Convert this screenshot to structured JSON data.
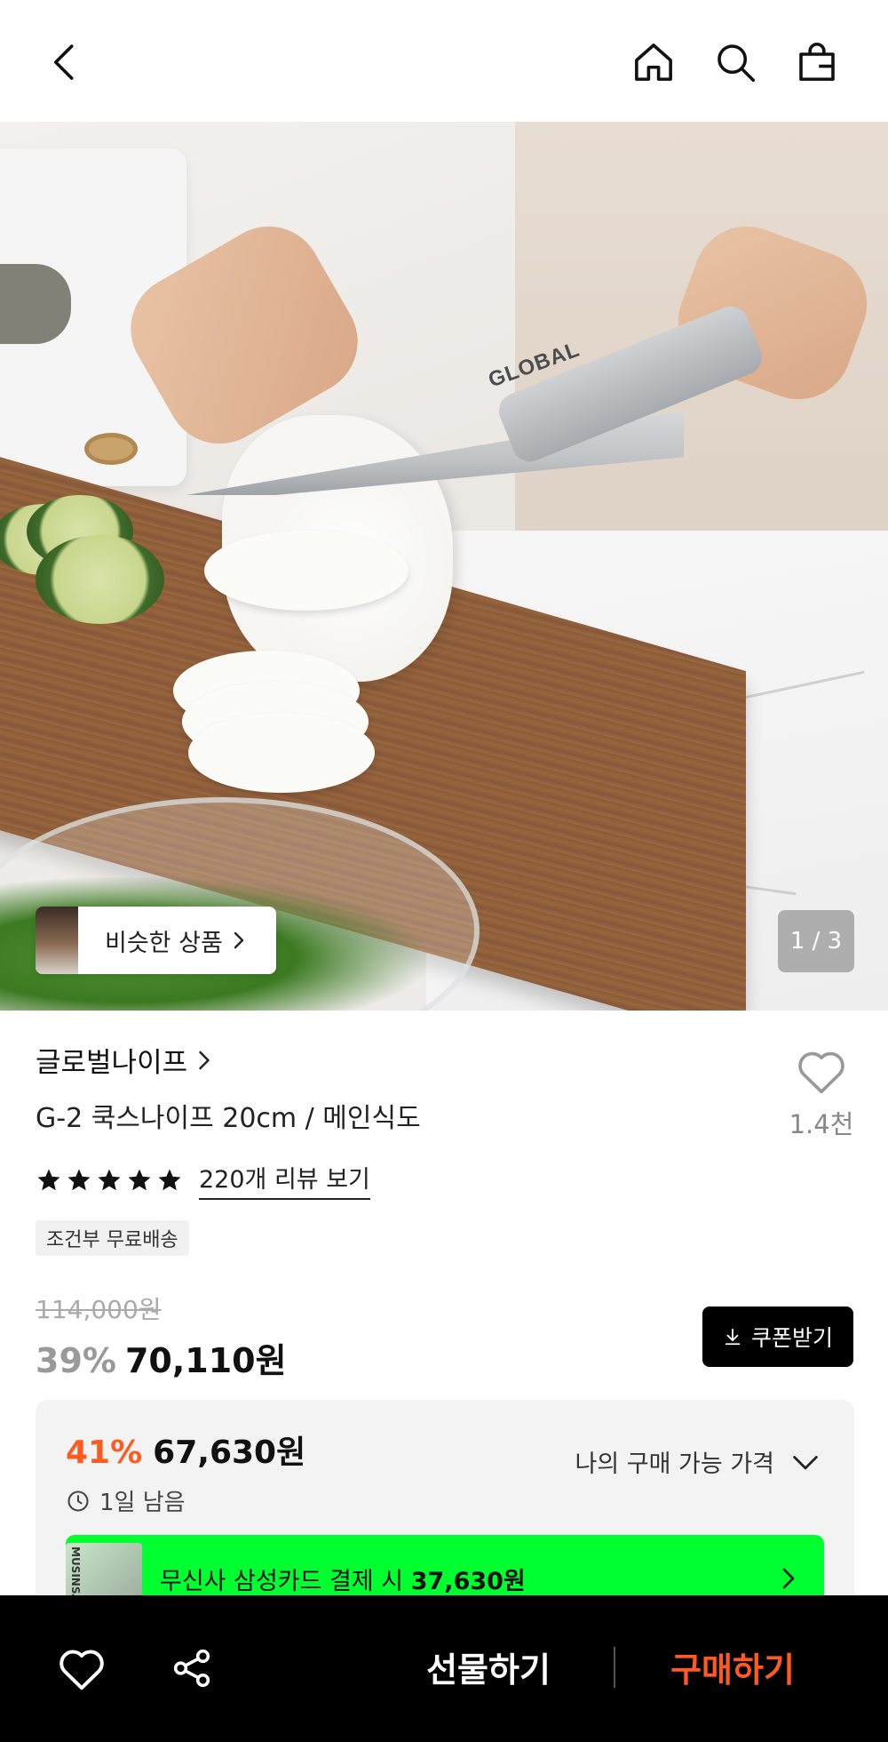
{
  "header": {
    "back_icon": "chevron-left-icon",
    "home_icon": "home-icon",
    "search_icon": "search-icon",
    "cart_icon": "shopping-bag-icon"
  },
  "gallery": {
    "similar_label": "비슷한 상품",
    "page_counter": "1 / 3",
    "knife_brand_engraving": "GLOBAL"
  },
  "product": {
    "brand": "글로벌나이프",
    "name": "G-2 쿡스나이프 20cm / 메인식도",
    "like_count": "1.4천",
    "rating_stars": 5,
    "review_link": "220개 리뷰 보기",
    "shipping_badge": "조건부 무료배송"
  },
  "pricing": {
    "original_price": "114,000원",
    "discount_pct": "39%",
    "sale_price": "70,110원",
    "coupon_label": "쿠폰받기"
  },
  "price_panel": {
    "best_pct": "41%",
    "best_price": "67,630원",
    "remaining": "1일 남음",
    "my_price_label": "나의 구매 가능 가격",
    "card_prefix": "무신사 삼성카드 결제 시 ",
    "card_price": "37,630원",
    "card_image_text": "MUSINSA"
  },
  "bottom_bar": {
    "gift_label": "선물하기",
    "buy_label": "구매하기"
  },
  "colors": {
    "accent_orange": "#ff5a1f",
    "card_green": "#00ff2e",
    "bottom_bar_bg": "#000000"
  }
}
